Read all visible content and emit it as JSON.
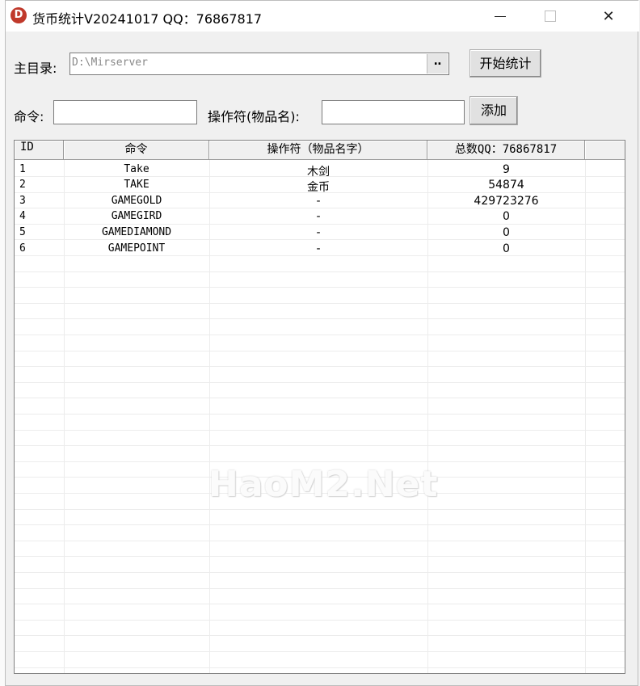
{
  "window": {
    "icon_letter": "D",
    "title": "货币统计V20241017 QQ：76867817",
    "controls": {
      "minimize": "",
      "maximize": "",
      "close": "✕"
    }
  },
  "form": {
    "dir_label": "主目录:",
    "dir_value": "D:\\Mirserver",
    "browse_label": "‥",
    "start_button": "开始统计",
    "command_label": "命令:",
    "command_value": "",
    "operator_label": "操作符(物品名):",
    "operator_value": "",
    "add_button": "添加"
  },
  "table": {
    "columns": [
      "ID",
      "命令",
      "操作符（物品名字）",
      "总数QQ：76867817",
      ""
    ],
    "rows": [
      {
        "id": "1",
        "command": "Take",
        "operator": "木剑",
        "total": "9"
      },
      {
        "id": "2",
        "command": "TAKE",
        "operator": "金币",
        "total": "54874"
      },
      {
        "id": "3",
        "command": "GAMEGOLD",
        "operator": "-",
        "total": "429723276"
      },
      {
        "id": "4",
        "command": "GAMEGIRD",
        "operator": "-",
        "total": "0"
      },
      {
        "id": "5",
        "command": "GAMEDIAMOND",
        "operator": "-",
        "total": "0"
      },
      {
        "id": "6",
        "command": "GAMEPOINT",
        "operator": "-",
        "total": "0"
      }
    ]
  },
  "watermark": "HaoM2.Net"
}
